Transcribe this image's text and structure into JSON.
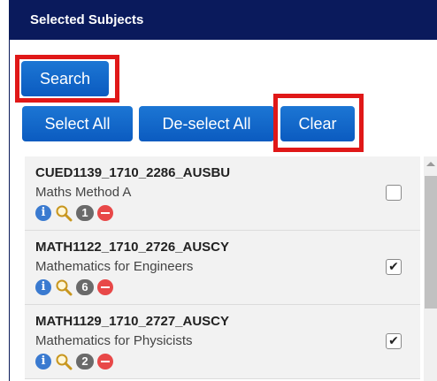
{
  "header": {
    "title": "Selected Subjects"
  },
  "buttons": {
    "search": "Search",
    "select_all": "Select All",
    "deselect_all": "De-select All",
    "clear": "Clear"
  },
  "subjects": [
    {
      "code": "CUED1139_1710_2286_AUSBU",
      "name": "Maths Method A",
      "count": "1",
      "checked": false
    },
    {
      "code": "MATH1122_1710_2726_AUSCY",
      "name": "Mathematics for Engineers",
      "count": "6",
      "checked": true
    },
    {
      "code": "MATH1129_1710_2727_AUSCY",
      "name": "Mathematics for Physicists",
      "count": "2",
      "checked": true
    }
  ],
  "icons": {
    "info": "info-icon",
    "search": "magnifier-icon",
    "remove": "remove-icon",
    "check_glyph": "✔"
  },
  "colors": {
    "header_bg": "#0a1a5c",
    "button_bg": "#0b5bc0",
    "highlight": "#e01818",
    "remove": "#e84848",
    "badge": "#6a6a6a"
  }
}
